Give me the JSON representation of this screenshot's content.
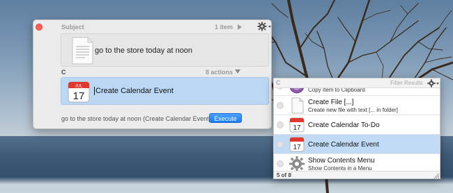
{
  "main_window": {
    "subject_title": "Subject",
    "subject_count": "1 item",
    "subject_text": "go to the store today at noon",
    "action_letter": "C",
    "action_count": "8 actions",
    "action_text": "Create Calendar Event",
    "status_text": "go to the store today at noon (Create Calendar Event)",
    "execute_label": "Execute",
    "calendar_icon": {
      "month": "JUL",
      "day": "17"
    }
  },
  "filter_panel": {
    "query_letter": "C",
    "header_label": "Filter Results",
    "footer_text": "5 of 8",
    "items": [
      {
        "title": "",
        "subtitle": "Copy Item to Clipboard",
        "icon": "clipboard-icon",
        "selected": false
      },
      {
        "title": "Create File [...]",
        "subtitle": "Create new file with text [... in folder]",
        "icon": "blank-document-icon",
        "selected": false
      },
      {
        "title": "Create Calendar To-Do",
        "subtitle": "",
        "icon": "calendar-icon",
        "selected": false
      },
      {
        "title": "Create Calendar Event",
        "subtitle": "",
        "icon": "calendar-icon",
        "selected": true
      },
      {
        "title": "Show Contents Menu",
        "subtitle": "Show Contents in a Menu",
        "icon": "gear-icon",
        "selected": false
      }
    ]
  },
  "colors": {
    "selection": "#c1dbf6",
    "execute_button": "#1a7cf2",
    "close_button": "#ff5f57"
  }
}
